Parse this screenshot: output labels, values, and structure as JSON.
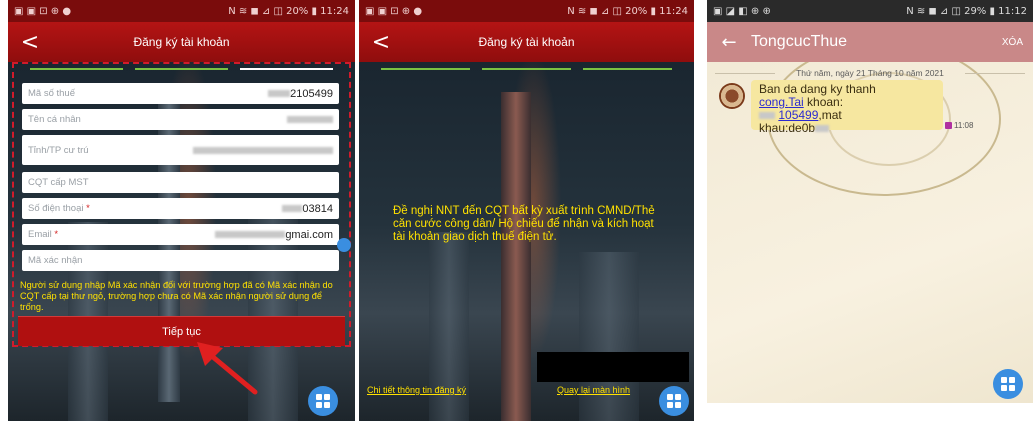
{
  "phone1": {
    "status": {
      "left": "▣ ▣ ⊡ ⊕ ●",
      "right": "N ≋ ◼ ⊿ ◫ 20% ▮ 11:24"
    },
    "title": "Đăng ký tài khoản",
    "back_icon": "<",
    "fields": [
      {
        "label": "Mã số thuế",
        "required": "",
        "value": "2105499"
      },
      {
        "label": "Tên cá nhân",
        "required": "",
        "value": ""
      },
      {
        "label": "Tỉnh/TP cư trú",
        "required": "",
        "value": ""
      },
      {
        "label": "CQT cấp MST",
        "required": "",
        "value": ""
      },
      {
        "label": "Số điện thoại",
        "required": "*",
        "value": "03814"
      },
      {
        "label": "Email",
        "required": "*",
        "value": "gmai.com"
      },
      {
        "label": "Mã xác nhận",
        "required": "",
        "value": ""
      }
    ],
    "note": "Người sử dụng nhập Mã xác nhận đối với trường hợp đã có Mã xác nhận do CQT cấp tại thư ngỏ, trường hợp chưa có Mã xác nhận người sử dụng để trống.",
    "submit_label": "Tiếp tục"
  },
  "phone2": {
    "status": {
      "left": "▣ ▣ ⊡ ⊕ ●",
      "right": "N ≋ ◼ ⊿ ◫ 20% ▮ 11:24"
    },
    "title": "Đăng ký tài khoản",
    "back_icon": "<",
    "message": "Đề nghị NNT đến CQT bất kỳ xuất trình CMND/Thẻ căn cước công dân/ Hộ chiếu để nhận và kích hoạt tài khoản giao dịch thuế điện tử.",
    "link_detail": "Chi tiết thông tin đăng ký",
    "link_back": "Quay lại màn hình"
  },
  "phone3": {
    "status": {
      "left": "▣ ◪ ◧ ⊕ ⊕",
      "right": "N ≋ ◼ ⊿ ◫ 29% ▮ 11:12"
    },
    "back_icon": "←",
    "title": "TongcucThue",
    "action": "XÓA",
    "date": "Thứ năm, ngày 21 Tháng 10 năm 2021",
    "message_lines": {
      "l1": "Ban da dang ky thanh",
      "l2a": "cong.",
      "l2b": "Tai",
      "l2c": " khoan:",
      "l3": "105499",
      "l3b": ",mat",
      "l4": "khau:de0b"
    },
    "time": "11:08"
  },
  "colors": {
    "brand_red": "#b41414",
    "note_yellow": "#ffe100",
    "fab_blue": "#3a8ee0",
    "highlight_red": "#d21b2b"
  }
}
